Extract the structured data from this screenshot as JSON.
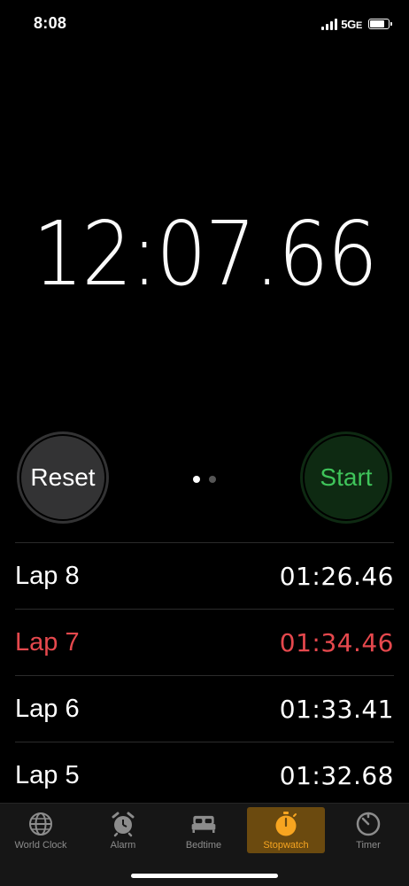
{
  "status_bar": {
    "time": "8:08",
    "network": "5G",
    "network_suffix": "E",
    "battery_level": 0.85
  },
  "stopwatch": {
    "elapsed": "12:07.66"
  },
  "controls": {
    "reset_label": "Reset",
    "start_label": "Start"
  },
  "laps": [
    {
      "name": "Lap 8",
      "time": "01:26.46",
      "slowest": false
    },
    {
      "name": "Lap 7",
      "time": "01:34.46",
      "slowest": true
    },
    {
      "name": "Lap 6",
      "time": "01:33.41",
      "slowest": false
    },
    {
      "name": "Lap 5",
      "time": "01:32.68",
      "slowest": false
    }
  ],
  "tabs": [
    {
      "label": "World Clock",
      "icon": "globe-icon",
      "active": false
    },
    {
      "label": "Alarm",
      "icon": "alarm-clock-icon",
      "active": false
    },
    {
      "label": "Bedtime",
      "icon": "bed-icon",
      "active": false
    },
    {
      "label": "Stopwatch",
      "icon": "stopwatch-icon",
      "active": true
    },
    {
      "label": "Timer",
      "icon": "timer-icon",
      "active": false
    }
  ],
  "colors": {
    "accent": "#f7a520",
    "start_green": "#3fc45a",
    "slowest_red": "#e5484d"
  }
}
